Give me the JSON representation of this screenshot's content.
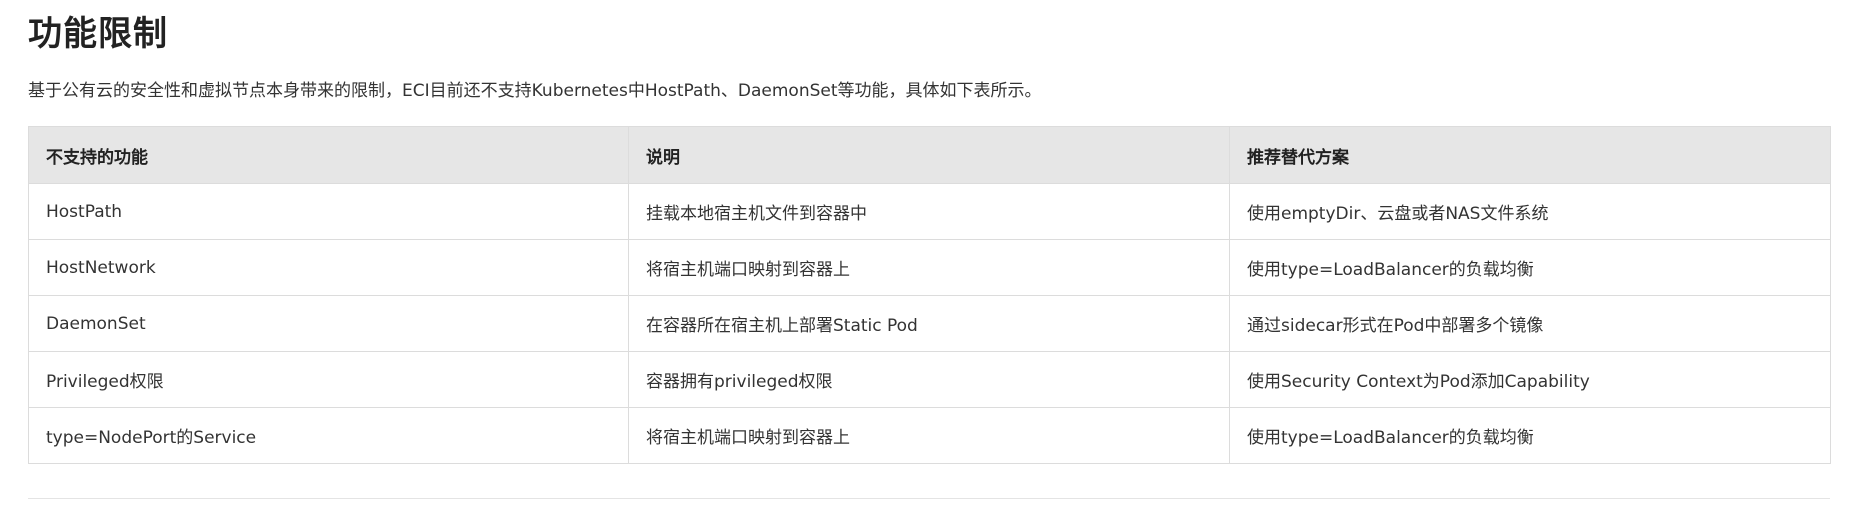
{
  "section": {
    "title": "功能限制",
    "intro": "基于公有云的安全性和虚拟节点本身带来的限制，ECI目前还不支持Kubernetes中HostPath、DaemonSet等功能，具体如下表所示。"
  },
  "table": {
    "headers": [
      "不支持的功能",
      "说明",
      "推荐替代方案"
    ],
    "rows": [
      [
        "HostPath",
        "挂载本地宿主机文件到容器中",
        "使用emptyDir、云盘或者NAS文件系统"
      ],
      [
        "HostNetwork",
        "将宿主机端口映射到容器上",
        "使用type=LoadBalancer的负载均衡"
      ],
      [
        "DaemonSet",
        "在容器所在宿主机上部署Static Pod",
        "通过sidecar形式在Pod中部署多个镜像"
      ],
      [
        "Privileged权限",
        "容器拥有privileged权限",
        "使用Security Context为Pod添加Capability"
      ],
      [
        "type=NodePort的Service",
        "将宿主机端口映射到容器上",
        "使用type=LoadBalancer的负载均衡"
      ]
    ]
  }
}
